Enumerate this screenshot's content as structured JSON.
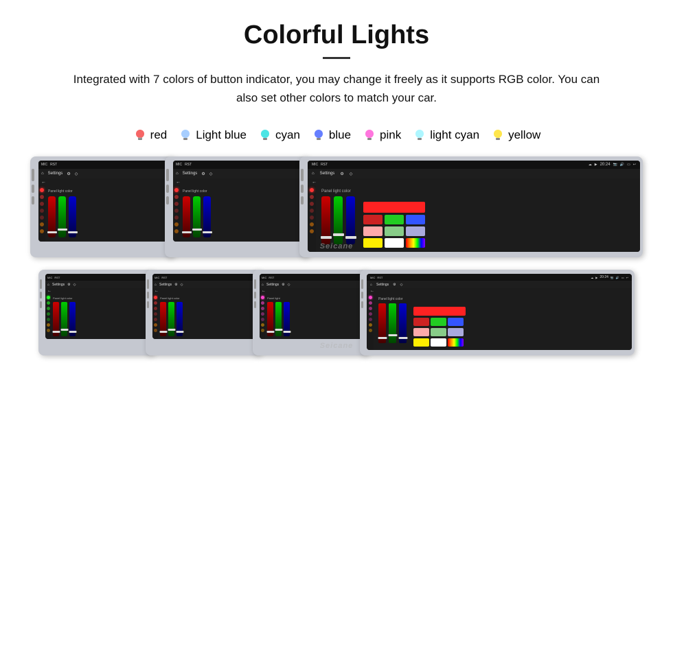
{
  "header": {
    "title": "Colorful Lights",
    "description": "Integrated with 7 colors of button indicator, you may change it freely as it supports RGB color. You can also set other colors to match your car."
  },
  "colors": [
    {
      "name": "red",
      "hex": "#ee3333",
      "glow": "#ff8888"
    },
    {
      "name": "Light blue",
      "hex": "#88bbff",
      "glow": "#bbddff"
    },
    {
      "name": "cyan",
      "hex": "#00cccc",
      "glow": "#88ffff"
    },
    {
      "name": "blue",
      "hex": "#3355ff",
      "glow": "#8899ff"
    },
    {
      "name": "pink",
      "hex": "#ff44cc",
      "glow": "#ff99ee"
    },
    {
      "name": "light cyan",
      "hex": "#88eeff",
      "glow": "#ccffff"
    },
    {
      "name": "yellow",
      "hex": "#ffdd00",
      "glow": "#ffee88"
    }
  ],
  "watermark": "Seicane",
  "nav": {
    "settings_label": "Settings",
    "home_icon": "⌂",
    "back_icon": "←"
  },
  "panel_light_label": "Panel light color",
  "status": {
    "time": "20:24"
  },
  "top_row_colors": [
    {
      "side_color": "#ff2222"
    },
    {
      "side_color": "#ff2222"
    },
    {
      "side_color": "#ff2222"
    }
  ],
  "bottom_row_colors": [
    {
      "side_color": "#22ff22"
    },
    {
      "side_color": "#ff2222"
    },
    {
      "side_color": "#ff66cc"
    },
    {
      "side_color": "#ff66cc"
    }
  ],
  "swatches": [
    [
      "#ff2222",
      "#22cc22",
      "#3355ff"
    ],
    [
      "#cc2222",
      "#22aa22",
      "#6677cc"
    ],
    [
      "#ffaaaa",
      "#88cc88",
      "#aaaadd"
    ],
    [
      "#ffee00",
      "#ffffff",
      "rainbow"
    ]
  ]
}
